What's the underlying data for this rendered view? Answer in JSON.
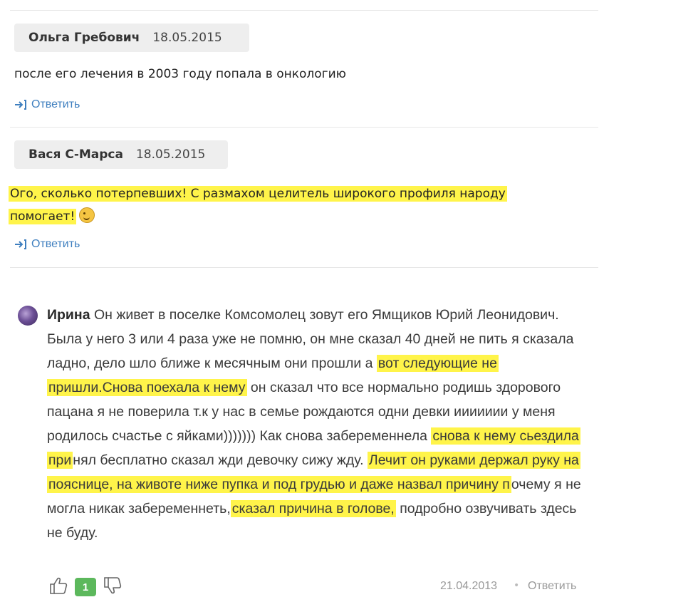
{
  "comments": [
    {
      "author": "Ольга Гребович",
      "date": "18.05.2015",
      "text": "после его лечения в 2003 году попала в онкологию",
      "reply_label": "Ответить"
    },
    {
      "author": "Вася С-Марса",
      "date": "18.05.2015",
      "text_line1": "Ого, сколько потерпевших! С размахом целитель широкого профиля народу",
      "text_line2": "помогает!",
      "reply_label": "Ответить"
    }
  ],
  "review": {
    "author": "Ирина",
    "segments": {
      "s1": "Он живет в поселке Комсомолец зовут его  Ямщиков Юрий Леонидович. Была у него 3 или 4 раза уже не помню, он мне сказал 40 дней не пить я сказала ладно, дело шло ближе к месячным они прошли а ",
      "h1": "вот следующие не пришли.Снова поехала к нему",
      "s2": " он сказал что все нормально родишь здорового пацана я не поверила т.к у нас в семье рождаются одни девки иииииии у меня родилось счастье с яйками))))))) Как снова забеременнела ",
      "h2": "снова к нему сьездила при",
      "s3": "нял бесплатно сказал жди девочку сижу жду.  ",
      "h3": "Лечит он руками держал руку на пояснице, на животе ниже пупка и под грудью и даже назвал причину п",
      "s4": "очему я не могла никак забеременнеть,",
      "h4": "сказал причина в голове,",
      "s5": " подробно озвучивать здесь не буду."
    },
    "likes": "1",
    "date": "21.04.2013",
    "separator": "•",
    "reply_label": "Ответить"
  },
  "colors": {
    "highlight": "#fff44a",
    "link": "#3f7fbf",
    "badge": "#5cb85c",
    "pill": "#eeeeee"
  },
  "icons": [
    "reply-arrow-icon",
    "thumbs-up-icon",
    "thumbs-down-icon",
    "winking-smiley-icon",
    "avatar"
  ]
}
